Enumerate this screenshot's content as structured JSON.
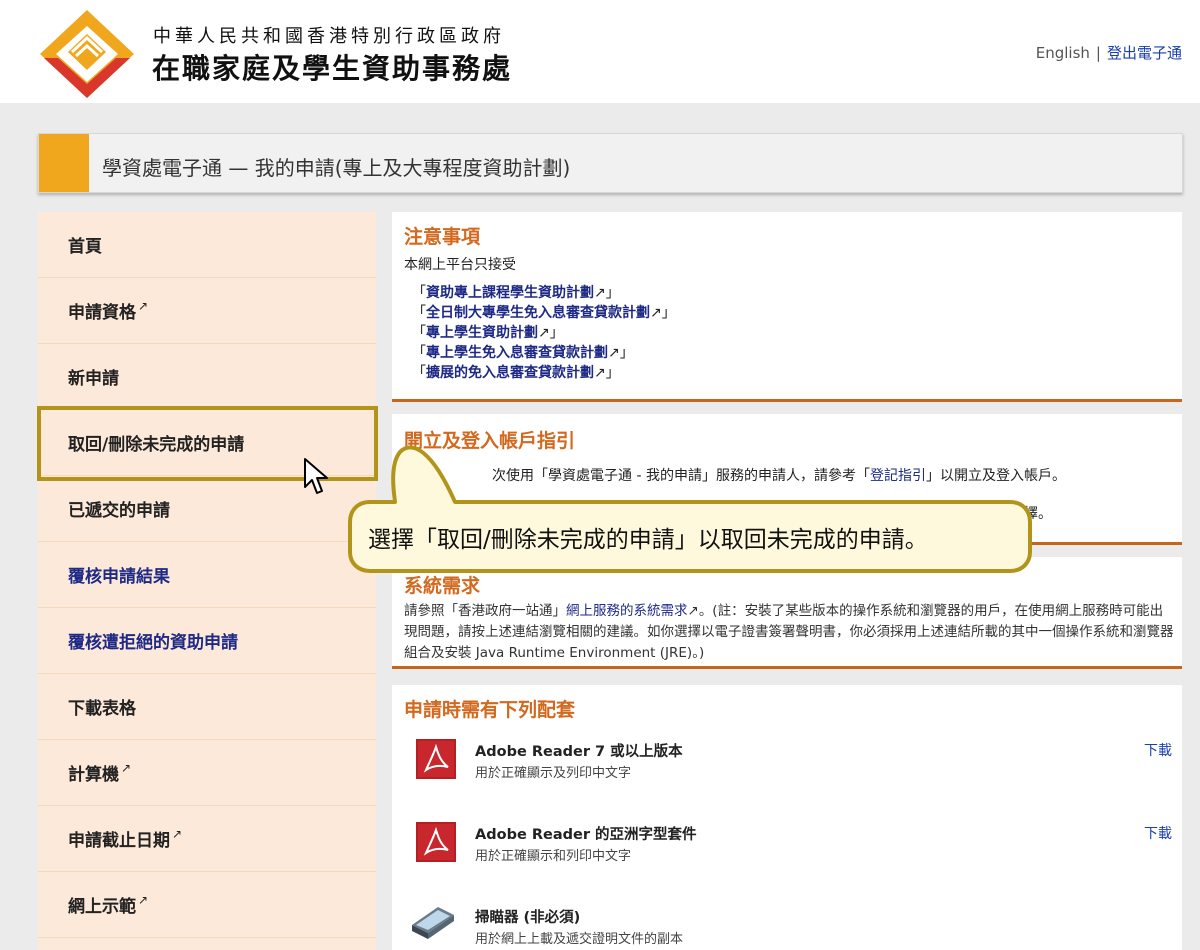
{
  "header": {
    "org_subtitle": "中華人民共和國香港特別行政區政府",
    "org_title": "在職家庭及學生資助事務處",
    "lang_link": "English",
    "separator": "|",
    "logout_link": "登出電子通"
  },
  "title_bar": {
    "title": "學資處電子通 — 我的申請(專上及大專程度資助計劃)"
  },
  "sidebar": {
    "items": [
      {
        "label": "首頁",
        "external": false
      },
      {
        "label": "申請資格",
        "external": true
      },
      {
        "label": "新申請",
        "external": false
      },
      {
        "label": "取回/刪除未完成的申請",
        "external": false
      },
      {
        "label": "已遞交的申請",
        "external": false
      },
      {
        "label": "覆核申請結果",
        "external": false
      },
      {
        "label": "覆核遭拒絕的資助申請",
        "external": false
      },
      {
        "label": "下載表格",
        "external": false
      },
      {
        "label": "計算機",
        "external": true
      },
      {
        "label": "申請截止日期",
        "external": true
      },
      {
        "label": "網上示範",
        "external": true
      }
    ],
    "external_icon": "↗"
  },
  "notice": {
    "heading": "注意事項",
    "intro": "本網上平台只接受",
    "links": [
      "資助專上課程學生資助計劃",
      "全日制大專學生免入息審查貸款計劃",
      "專上學生資助計劃",
      "專上學生免入息審查貸款計劃",
      "擴展的免入息審查貸款計劃"
    ]
  },
  "account_guide": {
    "heading": "開立及登入帳戶指引",
    "text_before": "次使用「學資處電子通 - 我的申請」服務的申請人，請參考「",
    "link": "登記指引",
    "text_after": "」以開立及登入帳戶。",
    "text2": "擇。"
  },
  "system_req": {
    "heading": "系統需求",
    "text_before": "請參照「香港政府一站通」",
    "link": "網上服務的系統需求",
    "text_after": "。(註：安裝了某些版本的操作系統和瀏覽器的用戶，在使用網上服務時可能出現問題，請按上述連結瀏覽相關的建議。如你選擇以電子證書簽署聲明書，你必須採用上述連結所載的其中一個操作系統和瀏覽器組合及安裝 Java Runtime Environment (JRE)。)"
  },
  "packages": {
    "heading": "申請時需有下列配套",
    "items": [
      {
        "name": "Adobe Reader 7 或以上版本",
        "desc": "用於正確顯示及列印中文字",
        "download": "下載",
        "icon": "adobe-reader-icon"
      },
      {
        "name": "Adobe Reader 的亞洲字型套件",
        "desc": "用於正確顯示和列印中文字",
        "download": "下載",
        "icon": "adobe-reader-icon"
      },
      {
        "name": "掃瞄器 (非必須)",
        "desc": "用於網上上載及遞交證明文件的副本",
        "download": "",
        "icon": "scanner-icon"
      }
    ]
  },
  "callout": {
    "text": "選擇「取回/刪除未完成的申請」以取回未完成的申請。"
  },
  "colors": {
    "accent_orange": "#f1a71d",
    "heading_orange": "#d2691e",
    "sidebar_bg": "#fde9d9",
    "highlight_gold": "#b3941a",
    "link_blue": "#1e2a86"
  }
}
